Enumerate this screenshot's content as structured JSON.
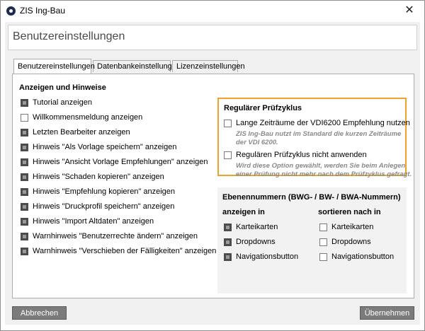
{
  "window": {
    "title": "ZIS Ing-Bau",
    "close_symbol": "✕"
  },
  "header": {
    "title": "Benutzereinstellungen"
  },
  "tabs": [
    {
      "label": "Benutzereinstellungen",
      "active": true
    },
    {
      "label": "Datenbankeinstellungen",
      "active": false
    },
    {
      "label": "Lizenzeinstellungen",
      "active": false
    }
  ],
  "left_section": {
    "title": "Anzeigen und Hinweise",
    "items": [
      {
        "label": "Tutorial anzeigen",
        "checked": true
      },
      {
        "label": "Willkommensmeldung anzeigen",
        "checked": false
      },
      {
        "label": "Letzten Bearbeiter anzeigen",
        "checked": true
      },
      {
        "label": "Hinweis \"Als Vorlage speichern\" anzeigen",
        "checked": true
      },
      {
        "label": "Hinweis \"Ansicht Vorlage Empfehlungen\" anzeigen",
        "checked": true
      },
      {
        "label": "Hinweis \"Schaden kopieren\" anzeigen",
        "checked": true
      },
      {
        "label": "Hinweis \"Empfehlung kopieren\" anzeigen",
        "checked": true
      },
      {
        "label": "Hinweis \"Druckprofil speichern\" anzeigen",
        "checked": true
      },
      {
        "label": "Hinweis \"Import Altdaten\" anzeigen",
        "checked": true
      },
      {
        "label": "Warnhinweis \"Benutzerrechte ändern\" anzeigen",
        "checked": true
      },
      {
        "label": "Warnhinweis \"Verschieben der Fälligkeiten\" anzeigen",
        "checked": true
      }
    ]
  },
  "pruefzyklus": {
    "title": "Regulärer Prüfzyklus",
    "option1": {
      "label": "Lange Zeiträume der VDI6200 Empfehlung nutzen",
      "checked": false,
      "note_line1": "ZIS Ing-Bau nutzt im Standard die kurzen Zeiträume",
      "note_line2": "der VDI 6200."
    },
    "option2": {
      "label": "Regulären Prüfzyklus nicht anwenden",
      "checked": false,
      "note_line1": "Wird diese Option gewählt, werden Sie beim Anlegen",
      "note_line2": "einer Prüfung nicht mehr nach dem Prüfzyklus gefragt."
    }
  },
  "ebenen": {
    "title": "Ebenennummern (BWG- / BW- / BWA-Nummern)",
    "show_title": "anzeigen in",
    "sort_title": "sortieren nach in",
    "show_items": [
      {
        "label": "Karteikarten",
        "checked": true
      },
      {
        "label": "Dropdowns",
        "checked": true
      },
      {
        "label": "Navigationsbutton",
        "checked": true
      }
    ],
    "sort_items": [
      {
        "label": "Karteikarten",
        "checked": false
      },
      {
        "label": "Dropdowns",
        "checked": false
      },
      {
        "label": "Navigationsbutton",
        "checked": false
      }
    ]
  },
  "footer": {
    "cancel_label": "Abbrechen",
    "apply_label": "Übernehmen"
  },
  "colors": {
    "accent_border": "#f0a32a",
    "button_bg": "#7b7b7b",
    "checkbox_checked": "#4c4c4c"
  }
}
